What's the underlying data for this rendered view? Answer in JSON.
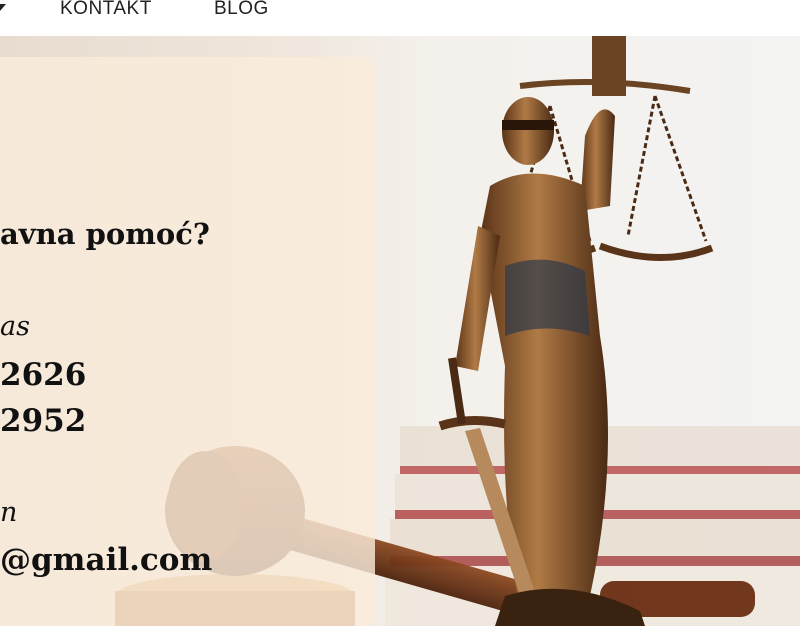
{
  "nav": {
    "items": [
      {
        "label": "KONTAKT"
      },
      {
        "label": "BLOG"
      }
    ]
  },
  "hero": {
    "image": "lady-justice-statue-with-gavel-and-books"
  },
  "card": {
    "heading": "avna pomoć?",
    "phone_label": "as",
    "phones": [
      "2626",
      "2952"
    ],
    "email_label": "n",
    "email": "@gmail.com"
  },
  "icons": {
    "nav_caret": "chevron-down-icon"
  }
}
